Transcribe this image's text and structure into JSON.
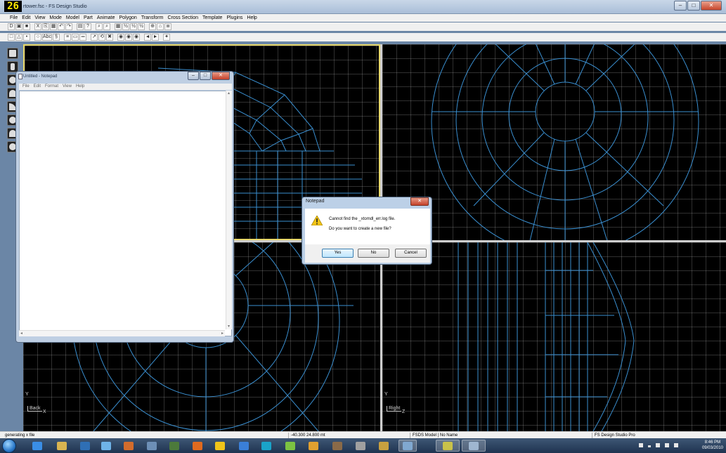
{
  "app": {
    "fps": "26",
    "title": "rtower.fsc - FS Design Studio",
    "minimize": "–",
    "maximize": "□",
    "close": "✕"
  },
  "menu": [
    "File",
    "Edit",
    "View",
    "Mode",
    "Model",
    "Part",
    "Animate",
    "Polygon",
    "Transform",
    "Cross Section",
    "Template",
    "Plugins",
    "Help"
  ],
  "toolbar1": [
    "D",
    "▣",
    "■",
    "|",
    "X",
    "⎘",
    "▦",
    "↶",
    "↷",
    "|",
    "▤",
    "?",
    "|",
    "⌕",
    "⌕",
    "|",
    "▦",
    "½",
    "½",
    "½",
    "|",
    "⊕",
    "⌂",
    "≣"
  ],
  "toolbar2": [
    "□",
    "△",
    "•",
    "|",
    "○",
    "Abc",
    "§",
    "|",
    "≡",
    "▭",
    "═",
    "|",
    "↗",
    "⟲",
    "✖",
    "|",
    "◉",
    "◉",
    "◉",
    "|",
    "◄",
    "►",
    "|",
    "✦"
  ],
  "viewports": {
    "bottom_left": {
      "axis_y": "Y",
      "label": "Back",
      "axis_x": "X"
    },
    "bottom_right": {
      "axis_y": "Y",
      "label": "Right",
      "axis_x": "Z"
    }
  },
  "notepad": {
    "title": "Untitled - Notepad",
    "menu": [
      "File",
      "Edit",
      "Format",
      "View",
      "Help"
    ],
    "content": ""
  },
  "dialog": {
    "title": "Notepad",
    "message1": "Cannot find the _xtomdl_err.log file.",
    "message2": "Do you want to create a new file?",
    "yes": "Yes",
    "no": "No",
    "cancel": "Cancel"
  },
  "status": {
    "left": "generating x file",
    "coords": "-40.300  24.800 mt",
    "model": "FSDS Model | No Name",
    "product": "FS Design Studio Pro"
  },
  "tray": {
    "time": "8:46 PM",
    "date": "09/03/2010"
  },
  "taskbar_colors": [
    "#3a8ee6",
    "#d9b451",
    "#2f6fb5",
    "#6fb3e8",
    "#d36c2c",
    "#6d8fb6",
    "#4c7a3b",
    "#e06a1f",
    "#f0c419",
    "#3a7fd8",
    "#1aa3c9",
    "#7cc242",
    "#e0a030",
    "#8a6a48",
    "#a0a0a0",
    "#c8a040",
    "#80a8d0"
  ],
  "accent": {
    "wire": "#3a8fd0",
    "grid": "#7f7f7f",
    "active_border": "#e8d86a"
  }
}
